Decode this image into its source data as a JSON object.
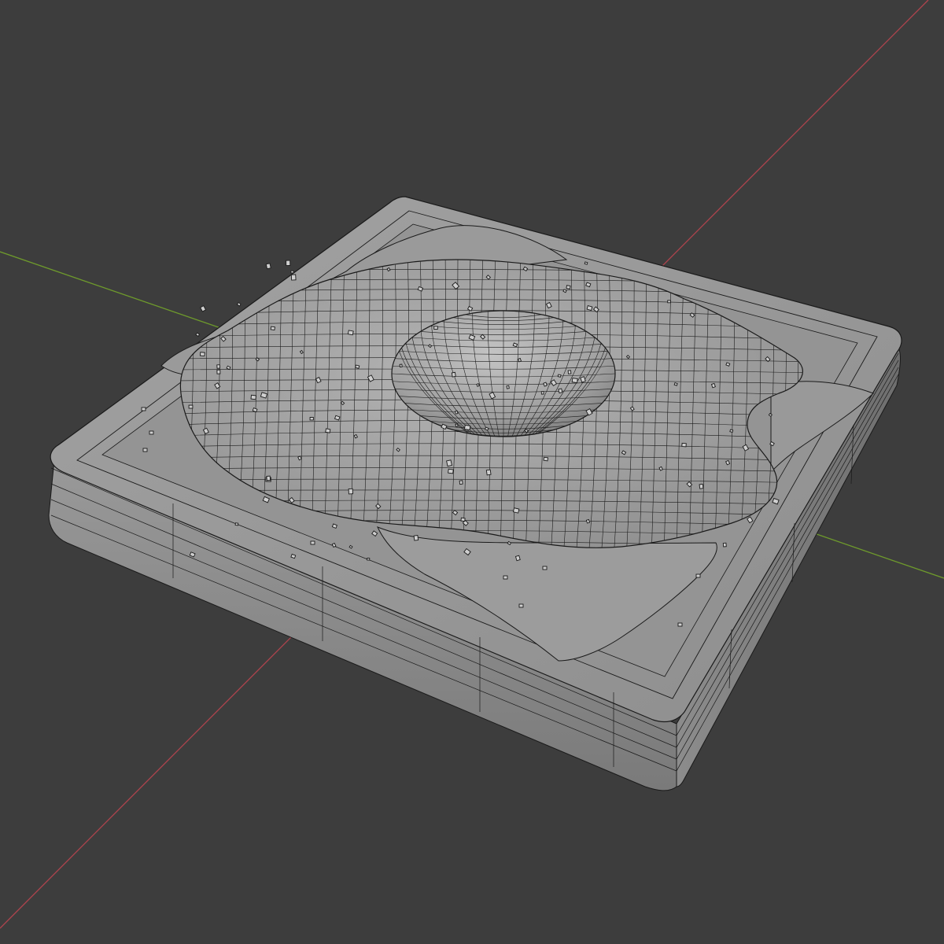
{
  "viewport": {
    "background_color": "#3d3d3d",
    "grid_color": "#444444",
    "x_axis_color": "#b0444e",
    "y_axis_color": "#6e9a2c",
    "wire_color": "#1a1a1a",
    "mesh_light": "#9b9b9b",
    "mesh_mid": "#8a8a8a",
    "mesh_dark": "#6a6a6a"
  },
  "scene": {
    "objects": [
      {
        "name": "toast-slice",
        "icon": "mesh-object-icon"
      },
      {
        "name": "fried-egg-white",
        "icon": "mesh-object-icon"
      },
      {
        "name": "egg-yolk",
        "icon": "mesh-object-icon"
      },
      {
        "name": "pepper-flakes",
        "icon": "particles-icon"
      }
    ]
  }
}
